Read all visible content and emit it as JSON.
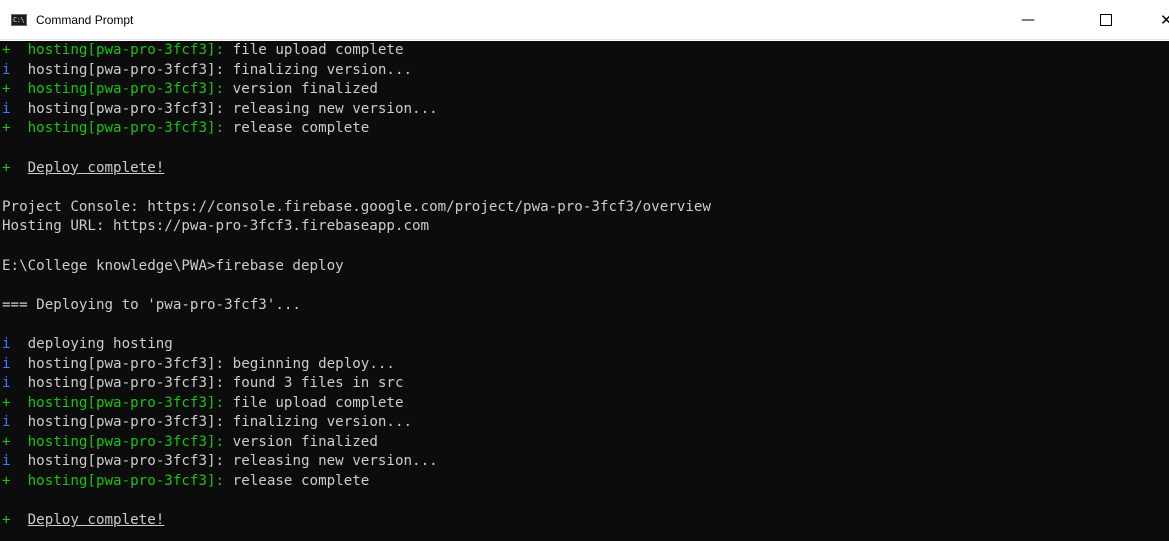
{
  "window": {
    "title": "Command Prompt",
    "app_icon_glyph": "C:\\",
    "minimize_glyph": "—",
    "close_glyph": "✕"
  },
  "colors": {
    "background": "#0c0c0c",
    "text": "#cccccc",
    "success": "#16c60c",
    "info": "#3b78ff"
  },
  "console": {
    "lines": [
      {
        "type": "ok",
        "prefix": "+",
        "tag": "hosting[pwa-pro-3fcf3]:",
        "text": " file upload complete"
      },
      {
        "type": "info",
        "prefix": "i",
        "tag": "hosting[pwa-pro-3fcf3]:",
        "text": " finalizing version..."
      },
      {
        "type": "ok",
        "prefix": "+",
        "tag": "hosting[pwa-pro-3fcf3]:",
        "text": " version finalized"
      },
      {
        "type": "info",
        "prefix": "i",
        "tag": "hosting[pwa-pro-3fcf3]:",
        "text": " releasing new version..."
      },
      {
        "type": "ok",
        "prefix": "+",
        "tag": "hosting[pwa-pro-3fcf3]:",
        "text": " release complete"
      },
      {
        "type": "blank"
      },
      {
        "type": "deploy",
        "prefix": "+",
        "text": "Deploy complete!"
      },
      {
        "type": "blank"
      },
      {
        "type": "plain",
        "text": "Project Console: https://console.firebase.google.com/project/pwa-pro-3fcf3/overview"
      },
      {
        "type": "plain",
        "text": "Hosting URL: https://pwa-pro-3fcf3.firebaseapp.com"
      },
      {
        "type": "blank"
      },
      {
        "type": "plain",
        "text": "E:\\College knowledge\\PWA>firebase deploy"
      },
      {
        "type": "blank"
      },
      {
        "type": "plain",
        "text": "=== Deploying to 'pwa-pro-3fcf3'..."
      },
      {
        "type": "blank"
      },
      {
        "type": "info-plain",
        "prefix": "i",
        "text": "deploying hosting"
      },
      {
        "type": "info",
        "prefix": "i",
        "tag": "hosting[pwa-pro-3fcf3]:",
        "text": " beginning deploy..."
      },
      {
        "type": "info",
        "prefix": "i",
        "tag": "hosting[pwa-pro-3fcf3]:",
        "text": " found 3 files in src"
      },
      {
        "type": "ok",
        "prefix": "+",
        "tag": "hosting[pwa-pro-3fcf3]:",
        "text": " file upload complete"
      },
      {
        "type": "info",
        "prefix": "i",
        "tag": "hosting[pwa-pro-3fcf3]:",
        "text": " finalizing version..."
      },
      {
        "type": "ok",
        "prefix": "+",
        "tag": "hosting[pwa-pro-3fcf3]:",
        "text": " version finalized"
      },
      {
        "type": "info",
        "prefix": "i",
        "tag": "hosting[pwa-pro-3fcf3]:",
        "text": " releasing new version..."
      },
      {
        "type": "ok",
        "prefix": "+",
        "tag": "hosting[pwa-pro-3fcf3]:",
        "text": " release complete"
      },
      {
        "type": "blank"
      },
      {
        "type": "deploy",
        "prefix": "+",
        "text": "Deploy complete!"
      }
    ]
  }
}
